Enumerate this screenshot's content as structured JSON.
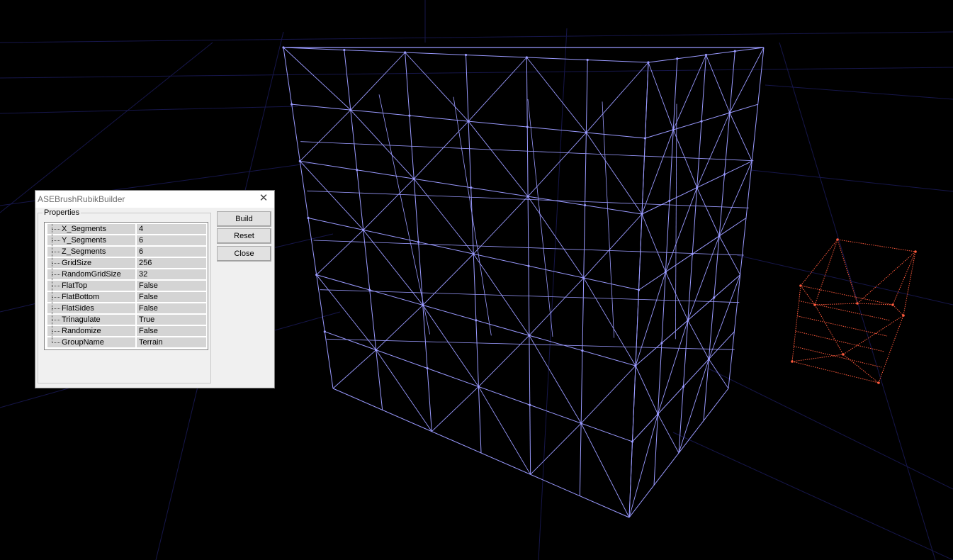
{
  "dialog": {
    "title": "ASEBrushRubikBuilder",
    "close_glyph": "✕",
    "properties_label": "Properties",
    "properties": [
      {
        "name": "X_Segments",
        "value": "4"
      },
      {
        "name": "Y_Segments",
        "value": "6"
      },
      {
        "name": "Z_Segments",
        "value": "6"
      },
      {
        "name": "GridSize",
        "value": "256"
      },
      {
        "name": "RandomGridSize",
        "value": "32"
      },
      {
        "name": "FlatTop",
        "value": "False"
      },
      {
        "name": "FlatBottom",
        "value": "False"
      },
      {
        "name": "FlatSides",
        "value": "False"
      },
      {
        "name": "Trinagulate",
        "value": "True"
      },
      {
        "name": "Randomize",
        "value": "False"
      },
      {
        "name": "GroupName",
        "value": "Terrain"
      }
    ],
    "buttons": {
      "build": "Build",
      "reset": "Reset",
      "close": "Close"
    }
  },
  "viewport": {
    "background_color": "#000000",
    "grid_color": "#16164a",
    "mesh_color": "#9a9aff",
    "preview_color": "#ff5a3c"
  }
}
